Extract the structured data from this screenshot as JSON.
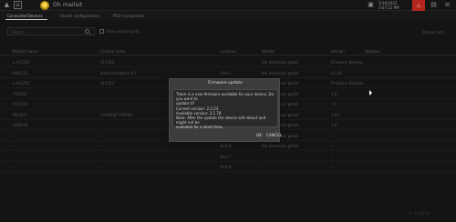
{
  "app": {
    "title": "Oh mailsit"
  },
  "topbar": {
    "datetime_line1": "5/16/2022",
    "datetime_line2": "3:07:22 PM"
  },
  "tabs": [
    {
      "label": "Connected Devices"
    },
    {
      "label": "Stored configurations"
    },
    {
      "label": "PSD Components"
    }
  ],
  "search": {
    "placeholder": "Search",
    "checkbox_label": "Show empty ports",
    "right_label": "Default sort"
  },
  "table": {
    "columns": [
      "Product name",
      "Custom name",
      "Location",
      "Vendor",
      "Version",
      "Updates"
    ],
    "rows": [
      [
        "▾ AL1350",
        "AL1350",
        "",
        "ifm electronic gmbh",
        "Firmware Release",
        ""
      ],
      [
        "  KH0123",
        "Instrumentation #1",
        "Port 1",
        "ifm electronic gmbh",
        "V1.00",
        ""
      ],
      [
        "▾ AL1353",
        "AL1353",
        "",
        "ifm electronic gmbh",
        "Firmware Release",
        ""
      ],
      [
        "  TV0103",
        "",
        "Port 1",
        "ifm electronic gmbh",
        "1.0",
        ""
      ],
      [
        "  O5D150",
        "",
        "Port 2",
        "ifm electronic gmbh",
        "1.0",
        ""
      ],
      [
        "  PN7677",
        "CURRENT TPR001",
        "Port 3",
        "ifm electronic gmbh",
        "1.03",
        ""
      ],
      [
        "  O5D135",
        "",
        "Port 4",
        "ifm electronic gmbh",
        "1.0",
        ""
      ],
      [
        "  --",
        "--",
        "Port 5",
        "ifm electronic gmbh",
        "--",
        ""
      ],
      [
        "  --",
        "--",
        "Port 6",
        "ifm electronic gmbh",
        "--",
        ""
      ],
      [
        "  --",
        "--",
        "Port 7",
        "--",
        "--",
        ""
      ],
      [
        "  --",
        "--",
        "Port 8",
        "--",
        "--",
        ""
      ]
    ]
  },
  "dialog": {
    "title": "Firmware update",
    "line1": "There is a new firmware available for your device. Do you want to",
    "line2": "update it?",
    "line3": "Current version: 2.3.23",
    "line4": "Available version: 3.1.78",
    "line5": "Note: After the update the device will reboot and might not be",
    "line6": "available for a short time.",
    "ok_label": "OK",
    "cancel_label": "CANCEL"
  },
  "pager": {
    "text": "1 - 11 of 11"
  },
  "icons": {
    "warning": "warning-icon",
    "home": "home-icon",
    "settings": "settings-icon",
    "alert": "alert-icon"
  },
  "colors": {
    "alert": "#b3261e",
    "logo": "#ffd54a"
  }
}
